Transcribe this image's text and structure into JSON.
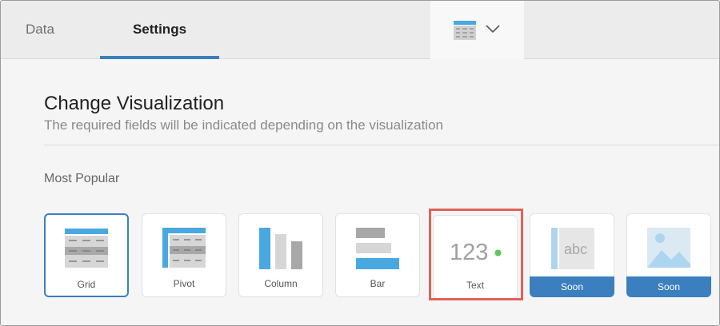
{
  "tabs": [
    {
      "label": "Data"
    },
    {
      "label": "Settings",
      "active": true
    }
  ],
  "viz_picker": {
    "icon": "grid-table-icon",
    "chevron": "chevron-down-icon"
  },
  "panel": {
    "title": "Change Visualization",
    "subtitle": "The required fields will be indicated depending on the visualization",
    "section": "Most Popular"
  },
  "cards": [
    {
      "label": "Grid",
      "icon": "grid-icon",
      "selected": true
    },
    {
      "label": "Pivot",
      "icon": "pivot-icon"
    },
    {
      "label": "Column",
      "icon": "column-chart-icon"
    },
    {
      "label": "Bar",
      "icon": "bar-chart-icon"
    },
    {
      "label": "Text",
      "icon": "text-123-icon",
      "glyph": "123",
      "highlighted": true
    },
    {
      "label": "Soon",
      "icon": "text-abc-icon",
      "glyph": "abc",
      "disabled": true
    },
    {
      "label": "Soon",
      "icon": "image-icon",
      "disabled": true
    }
  ],
  "colors": {
    "accent": "#3b7fbf",
    "highlight": "#e06359",
    "status_dot": "#5cc75c"
  }
}
